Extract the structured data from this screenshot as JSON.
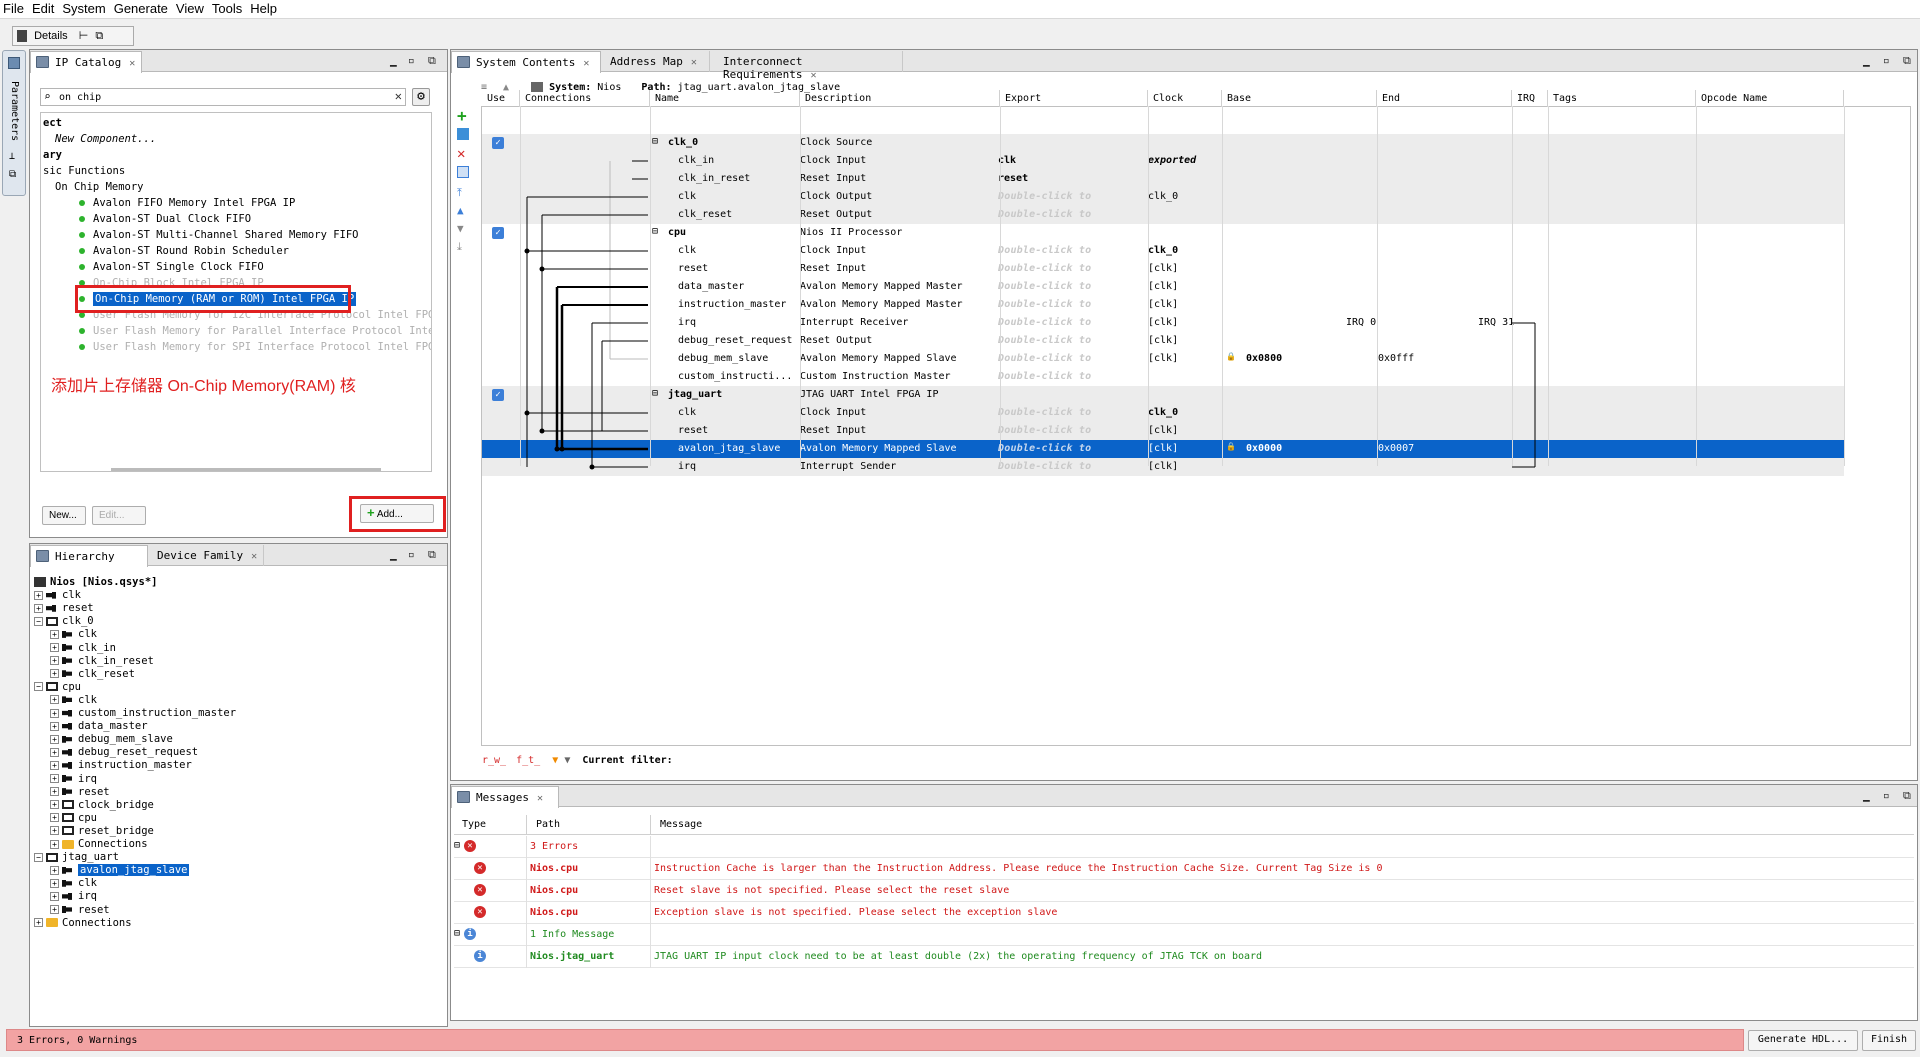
{
  "menu": [
    "File",
    "Edit",
    "System",
    "Generate",
    "View",
    "Tools",
    "Help"
  ],
  "details_tab": "Details",
  "left_strip_label": "Parameters",
  "ip_catalog": {
    "tab": "IP Catalog",
    "search_value": "on chip",
    "tree": [
      {
        "text": "ect",
        "indent": 0,
        "bold": true
      },
      {
        "text": "New Component...",
        "indent": 1,
        "italic": true
      },
      {
        "text": "ary",
        "indent": 0,
        "bold": true
      },
      {
        "text": "sic Functions",
        "indent": 0
      },
      {
        "text": "On Chip Memory",
        "indent": 1
      },
      {
        "text": "Avalon FIFO Memory Intel FPGA IP",
        "indent": 3,
        "dot": true
      },
      {
        "text": "Avalon-ST Dual Clock FIFO",
        "indent": 3,
        "dot": true
      },
      {
        "text": "Avalon-ST Multi-Channel Shared Memory FIFO",
        "indent": 3,
        "dot": true
      },
      {
        "text": "Avalon-ST Round Robin Scheduler",
        "indent": 3,
        "dot": true
      },
      {
        "text": "Avalon-ST Single Clock FIFO",
        "indent": 3,
        "dot": true
      },
      {
        "text": "On-Chip Block Intel FPGA IP",
        "indent": 3,
        "dot": true,
        "dim": true
      },
      {
        "text": "On-Chip Memory (RAM or ROM) Intel FPGA IP",
        "indent": 3,
        "dot": true,
        "selected": true
      },
      {
        "text": "User Flash Memory for I2C Interface Protocol Intel FPGA IP",
        "indent": 3,
        "dot": true,
        "dim": true
      },
      {
        "text": "User Flash Memory for Parallel Interface Protocol Intel FPGA IP",
        "indent": 3,
        "dot": true,
        "dim": true
      },
      {
        "text": "User Flash Memory for SPI Interface Protocol Intel FPGA IP",
        "indent": 3,
        "dot": true,
        "dim": true
      }
    ],
    "annotation": "添加片上存储器 On-Chip Memory(RAM) 核",
    "new_button": "New...",
    "edit_button": "Edit...",
    "add_button": "Add..."
  },
  "hierarchy": {
    "tabs": [
      "Hierarchy",
      "Device Family"
    ],
    "rows": [
      {
        "text": "Nios [Nios.qsys*]",
        "level": 0,
        "kind": "root"
      },
      {
        "text": "clk",
        "level": 0,
        "kind": "plug"
      },
      {
        "text": "reset",
        "level": 0,
        "kind": "plug"
      },
      {
        "text": "clk_0",
        "level": 0,
        "kind": "comp"
      },
      {
        "text": "clk",
        "level": 1,
        "kind": "plugin"
      },
      {
        "text": "clk_in",
        "level": 1,
        "kind": "plugin"
      },
      {
        "text": "clk_in_reset",
        "level": 1,
        "kind": "plugin"
      },
      {
        "text": "clk_reset",
        "level": 1,
        "kind": "plugin"
      },
      {
        "text": "cpu",
        "level": 0,
        "kind": "comp"
      },
      {
        "text": "clk",
        "level": 1,
        "kind": "plugin"
      },
      {
        "text": "custom_instruction_master",
        "level": 1,
        "kind": "plug"
      },
      {
        "text": "data_master",
        "level": 1,
        "kind": "plug"
      },
      {
        "text": "debug_mem_slave",
        "level": 1,
        "kind": "plugin"
      },
      {
        "text": "debug_reset_request",
        "level": 1,
        "kind": "plug"
      },
      {
        "text": "instruction_master",
        "level": 1,
        "kind": "plug"
      },
      {
        "text": "irq",
        "level": 1,
        "kind": "plugin"
      },
      {
        "text": "reset",
        "level": 1,
        "kind": "plugin"
      },
      {
        "text": "clock_bridge",
        "level": 1,
        "kind": "comp"
      },
      {
        "text": "cpu",
        "level": 1,
        "kind": "comp"
      },
      {
        "text": "reset_bridge",
        "level": 1,
        "kind": "comp"
      },
      {
        "text": "Connections",
        "level": 1,
        "kind": "folder"
      },
      {
        "text": "jtag_uart",
        "level": 0,
        "kind": "comp"
      },
      {
        "text": "avalon_jtag_slave",
        "level": 1,
        "kind": "plugin",
        "selected": true
      },
      {
        "text": "clk",
        "level": 1,
        "kind": "plugin"
      },
      {
        "text": "irq",
        "level": 1,
        "kind": "plug"
      },
      {
        "text": "reset",
        "level": 1,
        "kind": "plugin"
      },
      {
        "text": "Connections",
        "level": 0,
        "kind": "folder"
      }
    ]
  },
  "system": {
    "tabs": [
      "System Contents",
      "Address Map",
      "Interconnect Requirements"
    ],
    "system_label": "System:",
    "system_name": "Nios",
    "path_label": "Path:",
    "path_value": "jtag_uart.avalon_jtag_slave",
    "columns": [
      "Use",
      "Connections",
      "Name",
      "Description",
      "Export",
      "Clock",
      "Base",
      "End",
      "IRQ",
      "Tags",
      "Opcode Name"
    ],
    "rows": [
      {
        "name": "clk_0",
        "desc": "Clock Source",
        "export": "",
        "clock": "",
        "base": "",
        "end": "",
        "irq": "",
        "use": true,
        "header": true,
        "shade": true
      },
      {
        "name": "clk_in",
        "desc": "Clock Input",
        "export": "clk",
        "clock": "exported",
        "shade": true
      },
      {
        "name": "clk_in_reset",
        "desc": "Reset Input",
        "export": "reset",
        "clock": "",
        "shade": true
      },
      {
        "name": "clk",
        "desc": "Clock Output",
        "export": "Double-click to",
        "clock": "clk_0",
        "shade": true
      },
      {
        "name": "clk_reset",
        "desc": "Reset Output",
        "export": "Double-click to",
        "clock": "",
        "shade": true
      },
      {
        "name": "cpu",
        "desc": "Nios II Processor",
        "export": "",
        "clock": "",
        "use": true,
        "header": true
      },
      {
        "name": "clk",
        "desc": "Clock Input",
        "export": "Double-click to",
        "clock": "clk_0"
      },
      {
        "name": "reset",
        "desc": "Reset Input",
        "export": "Double-click to",
        "clock": "[clk]"
      },
      {
        "name": "data_master",
        "desc": "Avalon Memory Mapped Master",
        "export": "Double-click to",
        "clock": "[clk]"
      },
      {
        "name": "instruction_master",
        "desc": "Avalon Memory Mapped Master",
        "export": "Double-click to",
        "clock": "[clk]"
      },
      {
        "name": "irq",
        "desc": "Interrupt Receiver",
        "export": "Double-click to",
        "clock": "[clk]",
        "irq_a": "IRQ 0",
        "irq_b": "IRQ 31"
      },
      {
        "name": "debug_reset_request",
        "desc": "Reset Output",
        "export": "Double-click to",
        "clock": "[clk]"
      },
      {
        "name": "debug_mem_slave",
        "desc": "Avalon Memory Mapped Slave",
        "export": "Double-click to",
        "clock": "[clk]",
        "base": "0x0800",
        "end": "0x0fff"
      },
      {
        "name": "custom_instructi...",
        "desc": "Custom Instruction Master",
        "export": "Double-click to",
        "clock": ""
      },
      {
        "name": "jtag_uart",
        "desc": "JTAG UART Intel FPGA IP",
        "export": "",
        "clock": "",
        "use": true,
        "header": true,
        "shade": true
      },
      {
        "name": "clk",
        "desc": "Clock Input",
        "export": "Double-click to",
        "clock": "clk_0",
        "shade": true
      },
      {
        "name": "reset",
        "desc": "Reset Input",
        "export": "Double-click to",
        "clock": "[clk]",
        "shade": true
      },
      {
        "name": "avalon_jtag_slave",
        "desc": "Avalon Memory Mapped Slave",
        "export": "Double-click to",
        "clock": "[clk]",
        "base": "0x0000",
        "end": "0x0007",
        "selected": true
      },
      {
        "name": "irq",
        "desc": "Interrupt Sender",
        "export": "Double-click to",
        "clock": "[clk]",
        "shade": true
      }
    ],
    "filter_label": "Current filter:"
  },
  "messages": {
    "tab": "Messages",
    "columns": [
      "Type",
      "Path",
      "Message"
    ],
    "rows": [
      {
        "kind": "group-error",
        "path": "3 Errors",
        "message": ""
      },
      {
        "kind": "error",
        "path": "Nios.cpu",
        "message": "Instruction Cache is larger than the Instruction Address. Please reduce the Instruction Cache Size. Current Tag Size is 0"
      },
      {
        "kind": "error",
        "path": "Nios.cpu",
        "message": "Reset slave is not specified. Please select the reset slave"
      },
      {
        "kind": "error",
        "path": "Nios.cpu",
        "message": "Exception slave is not specified. Please select the exception slave"
      },
      {
        "kind": "group-info",
        "path": "1 Info Message",
        "message": ""
      },
      {
        "kind": "info",
        "path": "Nios.jtag_uart",
        "message": "JTAG UART IP input clock need to be at least double (2x) the operating frequency of JTAG TCK on board"
      }
    ]
  },
  "status": {
    "text": "3 Errors, 0 Warnings",
    "generate_button": "Generate HDL...",
    "finish_button": "Finish"
  },
  "colors": {
    "selection": "#0a63c9",
    "error": "#d01818",
    "status_bg": "#f2a3a3",
    "highlight_box": "#e02020"
  }
}
